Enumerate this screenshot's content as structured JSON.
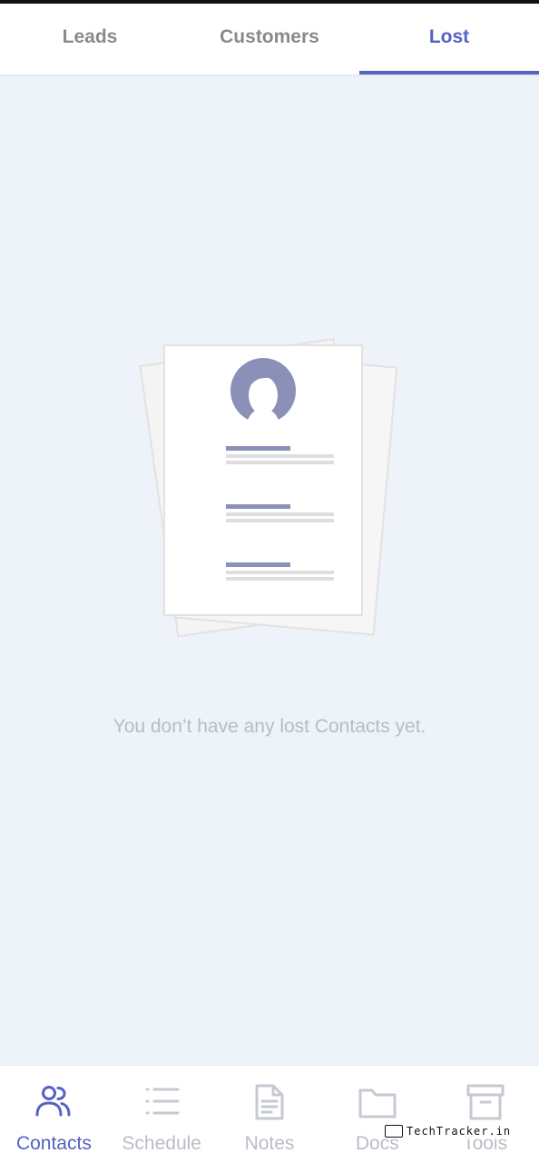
{
  "tabs": [
    {
      "label": "Leads",
      "active": false
    },
    {
      "label": "Customers",
      "active": false
    },
    {
      "label": "Lost",
      "active": true
    }
  ],
  "empty_state": {
    "message": "You don’t have any lost Contacts yet.",
    "illustration": "contact-documents-illustration"
  },
  "bottom_nav": [
    {
      "label": "Contacts",
      "icon": "contacts-icon",
      "active": true
    },
    {
      "label": "Schedule",
      "icon": "list-icon",
      "active": false
    },
    {
      "label": "Notes",
      "icon": "note-icon",
      "active": false
    },
    {
      "label": "Docs",
      "icon": "folder-icon",
      "active": false
    },
    {
      "label": "Tools",
      "icon": "archive-icon",
      "active": false
    }
  ],
  "watermark": "TechTracker.in",
  "colors": {
    "accent": "#5462c4",
    "background": "#eef2f9",
    "inactive": "#b9bdc6",
    "avatar": "#8b90b8"
  }
}
